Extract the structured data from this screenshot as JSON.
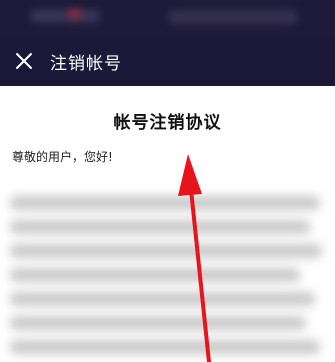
{
  "header": {
    "close_icon": "close-icon",
    "title": "注销帐号"
  },
  "document": {
    "title": "帐号注销协议",
    "greeting": "尊敬的用户，您好!"
  },
  "colors": {
    "header_bg": "#1b1838",
    "arrow": "#e8141c"
  }
}
